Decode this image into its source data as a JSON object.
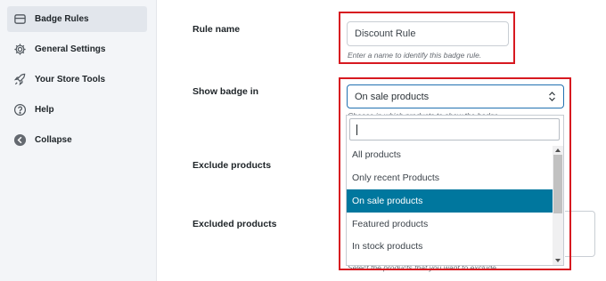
{
  "sidebar": {
    "items": [
      {
        "label": "Badge Rules",
        "icon": "badge-icon"
      },
      {
        "label": "General Settings",
        "icon": "gear-icon"
      },
      {
        "label": "Your Store Tools",
        "icon": "rocket-icon"
      },
      {
        "label": "Help",
        "icon": "help-icon"
      },
      {
        "label": "Collapse",
        "icon": "collapse-arrow-icon"
      }
    ]
  },
  "form": {
    "rule_name": {
      "label": "Rule name",
      "value": "Discount Rule",
      "hint": "Enter a name to identify this badge rule."
    },
    "show_badge_in": {
      "label": "Show badge in",
      "value": "On sale products",
      "hint": "Choose in which products to show the badge.",
      "search_value": "",
      "options": [
        "All products",
        "Only recent Products",
        "On sale products",
        "Featured products",
        "In stock products"
      ],
      "selected_option": "On sale products"
    },
    "exclude_products": {
      "label": "Exclude products"
    },
    "excluded_products": {
      "label": "Excluded products",
      "hint": "Select the products that you want to exclude."
    }
  },
  "colors": {
    "highlight_border": "#d71920",
    "selected_option_bg": "#00779e",
    "focus_border": "#2271b1"
  }
}
